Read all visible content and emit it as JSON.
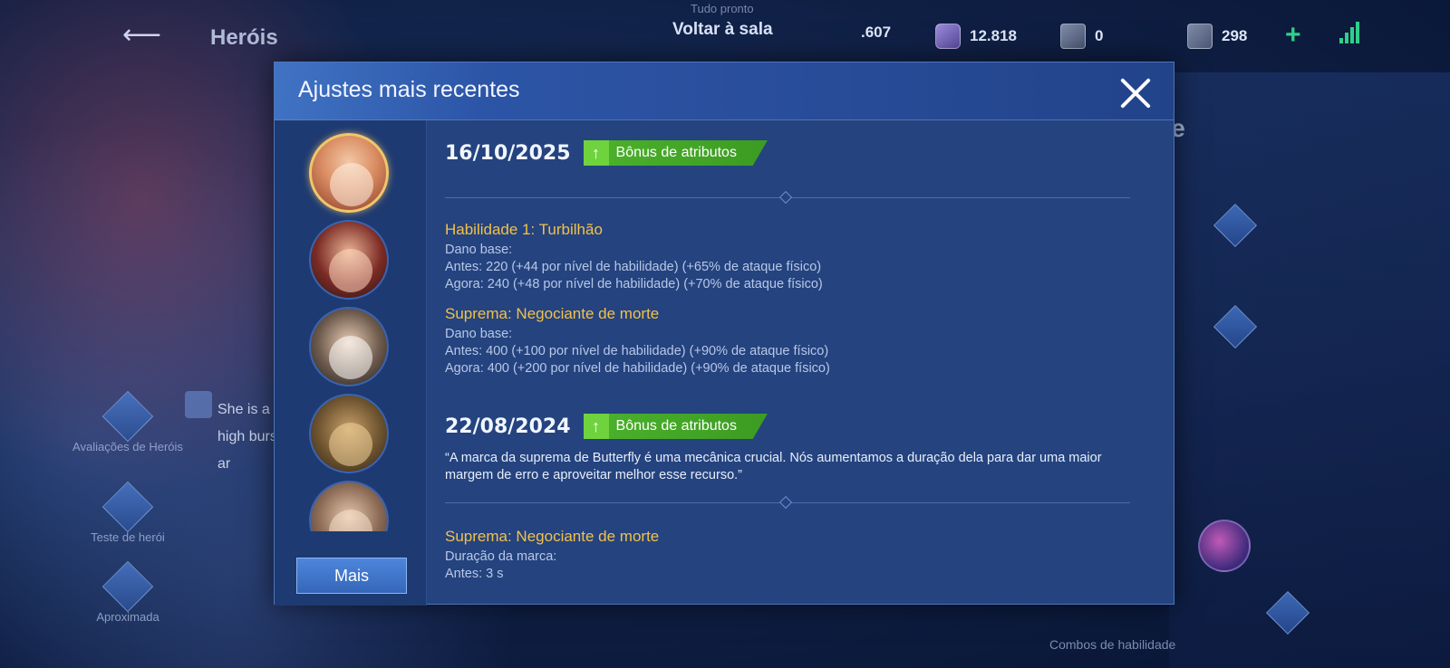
{
  "background": {
    "back_label": "Heróis",
    "room_status": "Tudo pronto",
    "room_back": "Voltar à sala",
    "currencies": [
      {
        "value": ".607"
      },
      {
        "value": "12.818"
      },
      {
        "value": "0"
      },
      {
        "value": "298"
      }
    ],
    "side_buttons": [
      {
        "label": "Avaliações de Heróis"
      },
      {
        "label": "Teste de herói"
      },
      {
        "label": "Aproximada"
      }
    ],
    "note_text": "She is a high burst ar",
    "right_title_fragment": "rte",
    "combos_label": "Combos de habilidade"
  },
  "dialog": {
    "title": "Ajustes mais recentes",
    "more_label": "Mais",
    "entries": [
      {
        "date": "16/10/2025",
        "badge": "Bônus de atributos",
        "sections": [
          {
            "title": "Habilidade 1: Turbilhão",
            "lines": [
              "Dano base:",
              "Antes: 220 (+44 por nível de habilidade) (+65% de ataque físico)",
              "Agora: 240 (+48 por nível de habilidade) (+70% de ataque físico)"
            ]
          },
          {
            "title": "Suprema: Negociante de morte",
            "lines": [
              "Dano base:",
              "Antes: 400 (+100 por nível de habilidade) (+90% de ataque físico)",
              "Agora: 400 (+200 por nível de habilidade) (+90% de ataque físico)"
            ]
          }
        ]
      },
      {
        "date": "22/08/2024",
        "badge": "Bônus de atributos",
        "quote": "“A marca da suprema de Butterfly é uma mecânica crucial. Nós aumentamos a duração dela para dar uma maior margem de erro e aproveitar melhor esse recurso.”",
        "sections": [
          {
            "title": "Suprema: Negociante de morte",
            "lines": [
              "Duração da marca:",
              "Antes: 3 s"
            ]
          }
        ]
      }
    ]
  },
  "colors": {
    "dialog_bg": "#24437f",
    "skill_title": "#f2c14a",
    "badge_green": "#4cb32c",
    "selected_ring": "#f0c66a"
  }
}
